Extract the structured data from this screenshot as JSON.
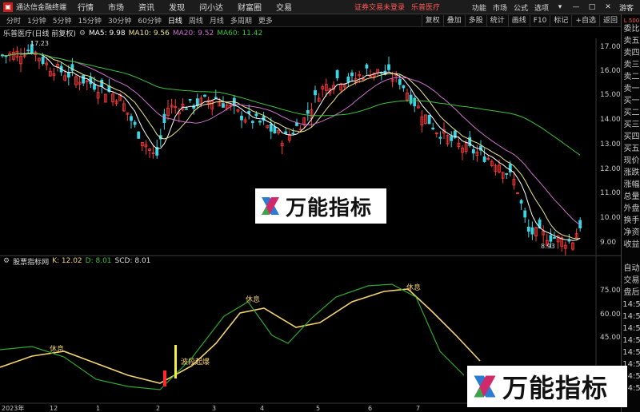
{
  "menubar": {
    "app_title": "通达信金融终端",
    "items": [
      "行情",
      "市场",
      "资讯",
      "发现",
      "问小达",
      "财富圈",
      "交易"
    ],
    "notice": "证券交易未登录",
    "stock_name": "乐普医疗",
    "right_items": [
      "功能",
      "市场",
      "公式",
      "选项"
    ],
    "guest": "游客",
    "win_buttons": [
      "▾",
      "—",
      "□",
      "✕"
    ]
  },
  "toolbar": {
    "periods": [
      "分时",
      "1分钟",
      "5分钟",
      "15分钟",
      "30分钟",
      "60分钟",
      "日线",
      "周线",
      "月线",
      "多周期",
      "更多"
    ],
    "active_period": "日线",
    "tools": [
      "复权",
      "叠加",
      "多股",
      "统计",
      "画线",
      "F10",
      "标记",
      "+自选",
      "返回"
    ]
  },
  "price_panel": {
    "title": "乐普医疗(日线 前复权)",
    "ma5": "MA5: 9.98",
    "ma10": "MA10: 9.56",
    "ma20": "MA20: 9.52",
    "ma60": "MA60: 11.42",
    "high_label": "17.23",
    "low_label": "8.93",
    "y_ticks": [
      "17.00",
      "16.00",
      "15.00",
      "14.00",
      "13.00",
      "12.00",
      "11.00",
      "10.00",
      "9.00"
    ]
  },
  "indicator_panel": {
    "title": "股票指标网",
    "k": "K: 12.02",
    "d": "D: 8.01",
    "scd": "SCD: 8.01",
    "y_ticks": [
      "75.00",
      "60.00",
      "45.00"
    ],
    "labels": [
      "休息",
      "休息",
      "休息",
      "波段起爆"
    ]
  },
  "x_axis": {
    "labels": [
      "2023年",
      "12",
      "1",
      "2",
      "3",
      "4",
      "5",
      "6",
      "7"
    ]
  },
  "sidepanel": {
    "items": [
      "委比",
      "卖五",
      "卖四",
      "卖三",
      "卖二",
      "卖一",
      "买一",
      "买二",
      "买三",
      "买四",
      "买五",
      "现价",
      "涨跌",
      "涨幅",
      "总量",
      "外盘",
      "换手",
      "净资",
      "收益",
      "",
      "自动",
      "交易",
      "盘后",
      "14:5",
      "14:5",
      "14:5",
      "14:5",
      "14:5",
      "14:5",
      "14:5",
      "14:5"
    ],
    "top_label": "L 500"
  },
  "watermark": {
    "text": "万能指标"
  },
  "colors": {
    "ma5": "#ffffff",
    "ma10": "#f0e68c",
    "ma20": "#d070d0",
    "ma60": "#3ec23e",
    "up": "#ff3b3b",
    "down": "#3ad6e6",
    "k_line": "#f5d36e",
    "d_line": "#2fa82f",
    "accent": "#c81e1e"
  }
}
